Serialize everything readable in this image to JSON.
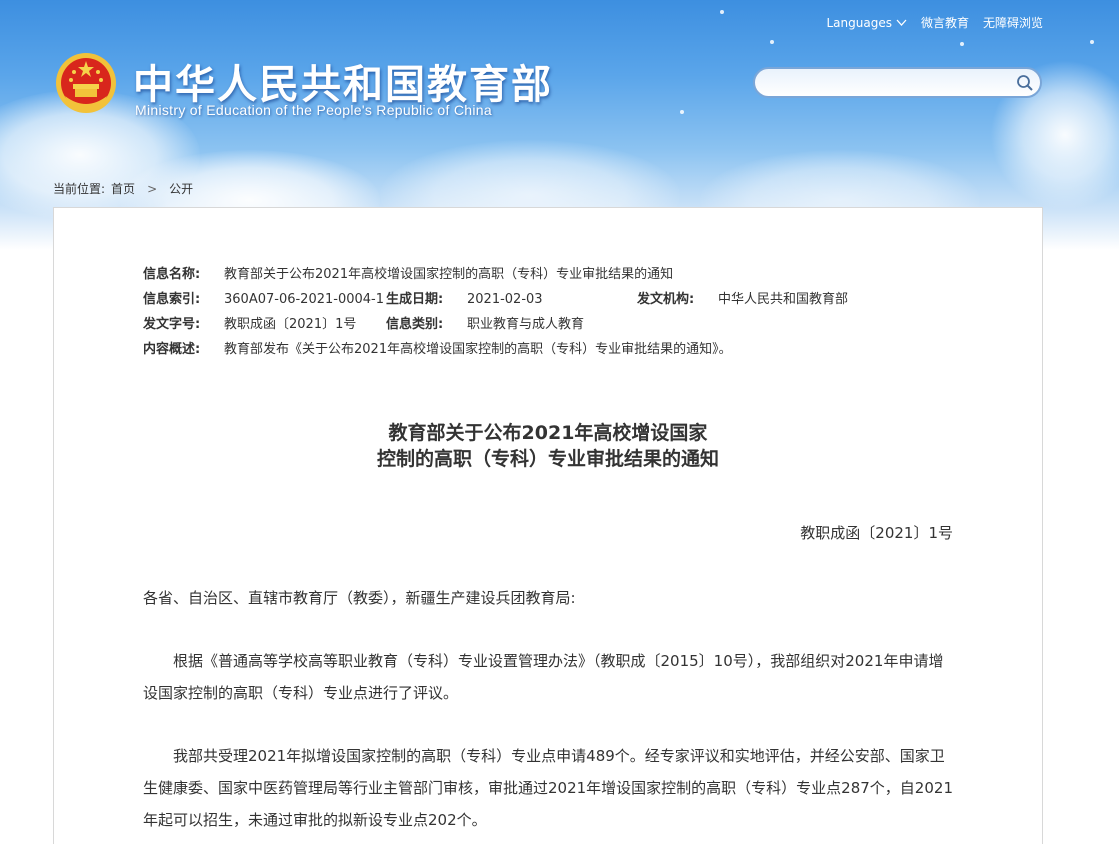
{
  "header": {
    "title_cn": "中华人民共和国教育部",
    "title_en": "Ministry of Education of the People's Republic of China",
    "emblem_icon": "national-emblem-icon",
    "topnav": {
      "languages": "Languages",
      "weibo": "微言教育",
      "accessible": "无障碍浏览"
    },
    "search": {
      "placeholder": "",
      "value": ""
    }
  },
  "breadcrumb": {
    "label": "当前位置:",
    "home": "首页",
    "separator": ">",
    "current": "公开"
  },
  "meta": {
    "name_key": "信息名称:",
    "name_value": "教育部关于公布2021年高校增设国家控制的高职（专科）专业审批结果的通知",
    "index_key": "信息索引:",
    "index_value": "360A07-06-2021-0004-1",
    "date_key": "生成日期:",
    "date_value": "2021-02-03",
    "org_key": "发文机构:",
    "org_value": "中华人民共和国教育部",
    "docno_key": "发文字号:",
    "docno_value": "教职成函〔2021〕1号",
    "category_key": "信息类别:",
    "category_value": "职业教育与成人教育",
    "summary_key": "内容概述:",
    "summary_value": "教育部发布《关于公布2021年高校增设国家控制的高职（专科）专业审批结果的通知》。"
  },
  "document": {
    "title_line1": "教育部关于公布2021年高校增设国家",
    "title_line2": "控制的高职（专科）专业审批结果的通知",
    "number": "教职成函〔2021〕1号",
    "salutation": "各省、自治区、直辖市教育厅（教委），新疆生产建设兵团教育局:",
    "paragraph1": "根据《普通高等学校高等职业教育（专科）专业设置管理办法》（教职成〔2015〕10号），我部组织对2021年申请增设国家控制的高职（专科）专业点进行了评议。",
    "paragraph2": "我部共受理2021年拟增设国家控制的高职（专科）专业点申请489个。经专家评议和实地评估，并经公安部、国家卫生健康委、国家中医药管理局等行业主管部门审核，审批通过2021年增设国家控制的高职（专科）专业点287个，自2021年起可以招生，未通过审批的拟新设专业点202个。"
  },
  "colors": {
    "header_top": "#3d8fe0",
    "text": "#333333",
    "panel_border": "#d8d8d8",
    "search_border": "#7aa6d8"
  }
}
